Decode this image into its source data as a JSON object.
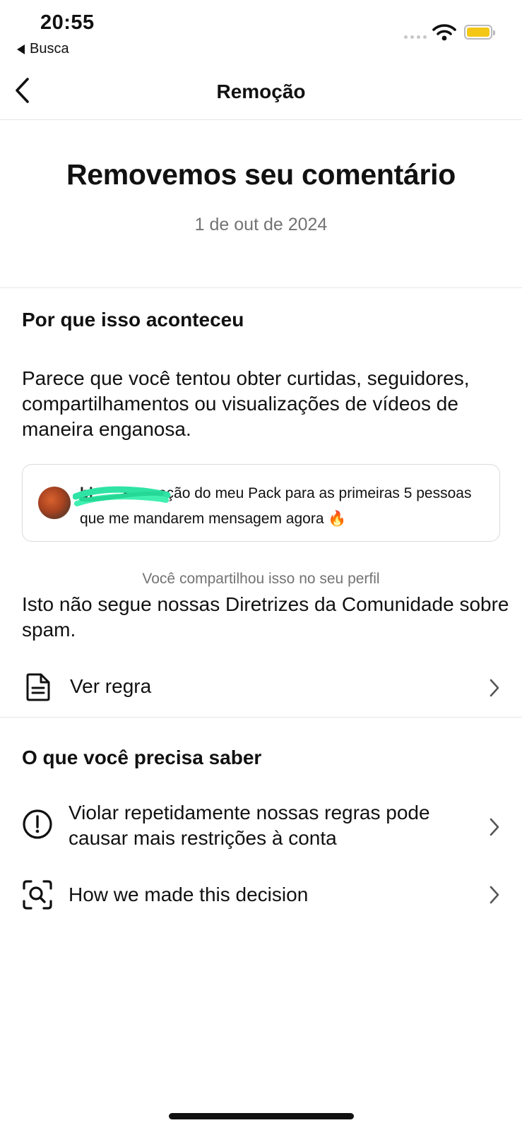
{
  "status_bar": {
    "time": "20:55",
    "back_app": "Busca",
    "battery_color": "#f4c716"
  },
  "header": {
    "title": "Remoção"
  },
  "notice": {
    "title": "Removemos seu comentário",
    "date": "1 de out de 2024"
  },
  "why": {
    "heading": "Por que isso aconteceu",
    "explanation": "Parece que você tentou obter curtidas, seguidores, compartilhamentos ou visualizações de vídeos de maneira enganosa.",
    "comment": {
      "username": "bl          ",
      "text": "Promoção do meu Pack para as primeiras 5 pessoas que me mandarem mensagem agora 🔥"
    },
    "shared_note": "Você compartilhou isso no seu perfil",
    "guideline_note": "Isto não segue nossas Diretrizes da Comunidade sobre spam.",
    "rule_link": "Ver regra"
  },
  "know": {
    "heading": "O que você precisa saber",
    "items": [
      {
        "icon": "exclamation-circle-icon",
        "label": "Violar repetidamente nossas regras pode causar mais restrições à conta"
      },
      {
        "icon": "search-scan-icon",
        "label": "How we made this decision"
      }
    ]
  }
}
